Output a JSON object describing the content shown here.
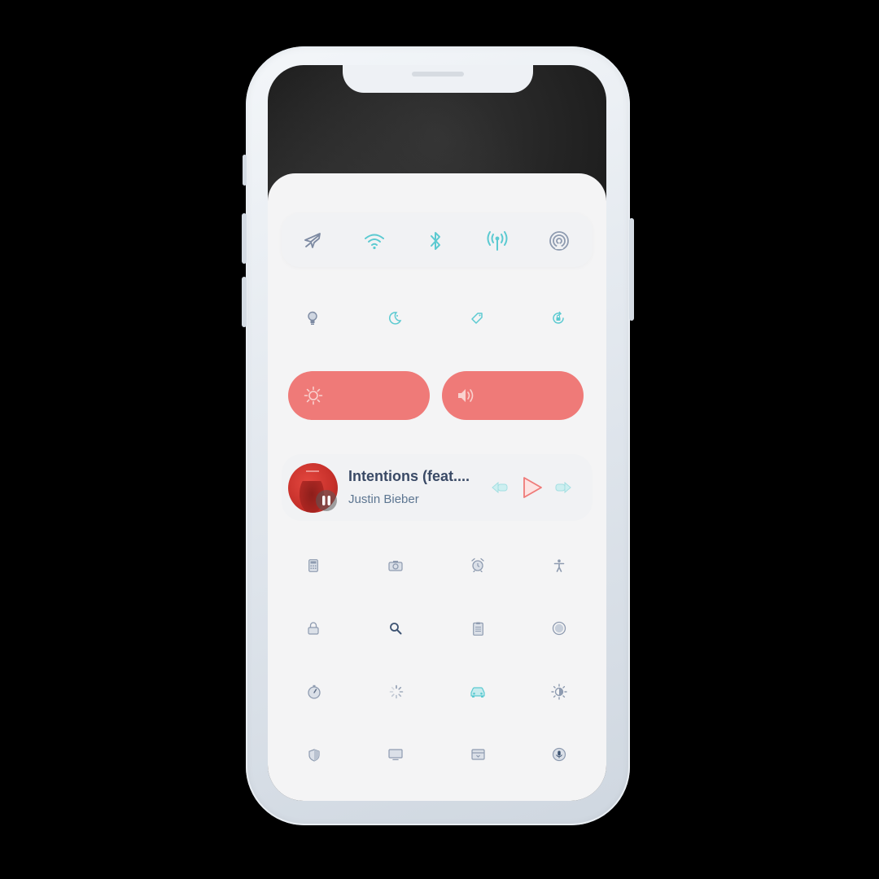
{
  "colors": {
    "accent": "#5ccad1",
    "icon_gray": "#8e9bb0",
    "slider": "#ef7a78",
    "title": "#3a4a66"
  },
  "connectivity": [
    {
      "icon": "airplane-icon",
      "active": false
    },
    {
      "icon": "wifi-icon",
      "active": true
    },
    {
      "icon": "bluetooth-icon",
      "active": true
    },
    {
      "icon": "cellular-icon",
      "active": true
    },
    {
      "icon": "airdrop-icon",
      "active": false
    }
  ],
  "quick_toggles": [
    {
      "icon": "lightbulb-icon"
    },
    {
      "icon": "moon-icon"
    },
    {
      "icon": "tag-icon"
    },
    {
      "icon": "rotation-lock-icon"
    }
  ],
  "sliders": {
    "brightness": {
      "icon": "sun-icon"
    },
    "volume": {
      "icon": "speaker-icon"
    }
  },
  "now_playing": {
    "title": "Intentions (feat....",
    "artist": "Justin Bieber"
  },
  "app_grid": [
    [
      "calculator-icon",
      "camera-icon",
      "alarm-clock-icon",
      "accessibility-icon"
    ],
    [
      "lock-icon",
      "magnifier-icon",
      "notes-icon",
      "record-icon"
    ],
    [
      "timer-icon",
      "loading-icon",
      "car-icon",
      "appearance-icon"
    ],
    [
      "shield-icon",
      "screen-mirroring-icon",
      "wallet-icon",
      "voice-memo-icon"
    ]
  ]
}
